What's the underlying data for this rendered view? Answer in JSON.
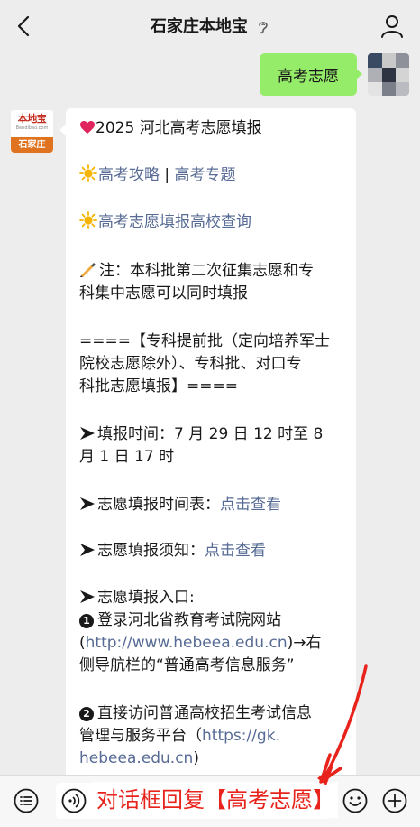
{
  "header": {
    "title": "石家庄本地宝",
    "back_icon": "chevron-left-icon",
    "ear_icon": "ear-icon",
    "profile_icon": "person-icon"
  },
  "sent_message": {
    "text": "高考志愿"
  },
  "account_avatar": {
    "logo": "本地宝",
    "domain": "Bendibao.com",
    "city": "石家庄"
  },
  "reply": {
    "title": "2025 河北高考志愿填报",
    "link_strategy": "高考攻略",
    "separator": "|",
    "link_topic": "高考专题",
    "link_query": "高考志愿填报高校查询",
    "note_line1": "注：本科批第二次征集志愿和专",
    "note_line2": "科集中志愿可以同时填报",
    "section_line1": "====【专科提前批（定向培养军士",
    "section_line2": "院校志愿除外）、专科批、对口专",
    "section_line3": "科批志愿填报】====",
    "time_line1": "填报时间：7 月 29 日 12 时至 8",
    "time_line2": "月 1 日 17 时",
    "schedule_label": "志愿填报时间表：",
    "schedule_link": "点击查看",
    "notice_label": "志愿填报须知：",
    "notice_link": "点击查看",
    "entry_label": "志愿填报入口:",
    "entry1_num": "1",
    "entry1_line1": "登录河北省教育考试院网站",
    "entry1_url": "http://www.hebeea.edu.cn",
    "entry1_paren_open": "(",
    "entry1_after": ")→右",
    "entry1_line3": "侧导航栏的“普通高考信息服务”",
    "entry2_num": "2",
    "entry2_line1": "直接访问普通高校招生考试信息",
    "entry2_line2_text": "管理与服务平台（",
    "entry2_url_part1": "https://gk.",
    "entry2_url_part2": "hebeea.edu.cn",
    "entry2_close": ")"
  },
  "bottom_bar": {
    "menu_icon": "list-menu-icon",
    "voice_icon": "voice-icon",
    "emoji_icon": "smile-icon",
    "plus_icon": "plus-icon",
    "overlay_text": "对话框回复【高考志愿】"
  },
  "colors": {
    "background": "#ededed",
    "sent_bubble": "#95ec69",
    "link": "#576b95",
    "overlay_red": "#e8231b",
    "avatar_orange": "#e0731f"
  }
}
